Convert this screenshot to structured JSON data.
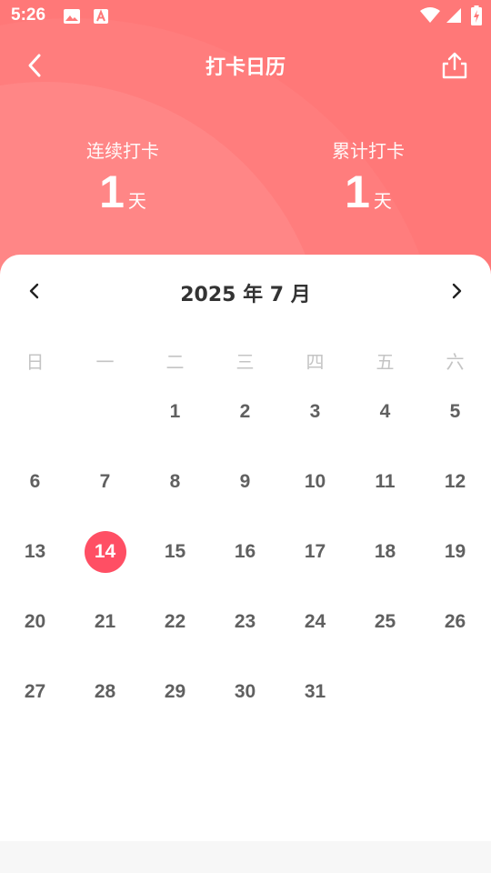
{
  "status_bar": {
    "time": "5:26",
    "icons": [
      "image-icon",
      "a-icon",
      "wifi-icon",
      "signal-icon",
      "battery-icon"
    ]
  },
  "toolbar": {
    "title": "打卡日历",
    "back_icon": "chevron-left-icon",
    "share_icon": "share-icon"
  },
  "stats": {
    "streak": {
      "label": "连续打卡",
      "value": "1",
      "unit": "天"
    },
    "total": {
      "label": "累计打卡",
      "value": "1",
      "unit": "天"
    }
  },
  "calendar": {
    "month_title": "2025 年 7 月",
    "weekdays": [
      "日",
      "一",
      "二",
      "三",
      "四",
      "五",
      "六"
    ],
    "first_weekday_index": 2,
    "days_in_month": 31,
    "today": 14,
    "today_color": "#ff4f64"
  },
  "colors": {
    "header": "#ff7878",
    "day_text": "#606060",
    "weekday_text": "#c4c4c4"
  }
}
